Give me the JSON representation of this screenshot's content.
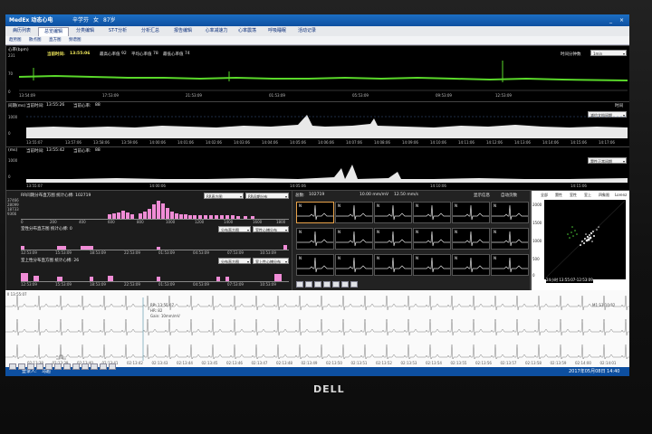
{
  "window": {
    "brand": "MedEx 动态心电",
    "patient_name": "辛学芬",
    "patient_sex": "女",
    "patient_age": "87岁",
    "close_label": "×",
    "min_label": "_"
  },
  "menu": [
    {
      "label": "病历列表"
    },
    {
      "label": "总览编辑"
    },
    {
      "label": "分类编辑"
    },
    {
      "label": "ST-T分析"
    },
    {
      "label": "分析汇总"
    },
    {
      "label": "报告编辑"
    },
    {
      "label": "心率减速力"
    },
    {
      "label": "心率震荡"
    },
    {
      "label": "呼吸睡眠"
    },
    {
      "label": "活动记录"
    }
  ],
  "submenu": [
    {
      "label": "趋势图"
    },
    {
      "label": "散点图"
    },
    {
      "label": "直方图"
    },
    {
      "label": "频谱图"
    }
  ],
  "hr_trend": {
    "axis_title": "心率(bpm)",
    "y_max": "231",
    "y_mid": "70",
    "y_min": "0",
    "current_label": "当前时间:",
    "current_time": "13:55:06",
    "max_hr_label": "最高心率值",
    "max_hr": "92",
    "avg_hr_label": "平均心率值",
    "avg_hr": "78",
    "min_hr_label": "最低心率值",
    "min_hr": "74",
    "ticks": [
      "13:54:09",
      "17:53:09",
      "21:53:09",
      "01:53:09",
      "05:53:09",
      "09:53:09",
      "12:53:09"
    ],
    "dropdown_label": "时间分钟数",
    "dropdown_value": "1min"
  },
  "rr_trend": {
    "axis_title": "间期(ms)",
    "y_max": "1000",
    "y_min": "0",
    "current_label": "当前时间:",
    "current_time": "13:55:26",
    "hr_label": "当前心率:",
    "hr": "88",
    "right_label": "时间",
    "dropdown_value": "减约文档间期"
  },
  "rr_trend2": {
    "axis_title": "(ms)",
    "y_max": "1000",
    "y_min": "0",
    "current_label": "当前时间:",
    "current_time": "13:55:42",
    "hr_label": "当前心率:",
    "hr": "88",
    "dropdown_value": "窦性正常间期"
  },
  "trend_ticks": [
    "13:55:07",
    "13:57:06",
    "13:58:06",
    "13:59:06",
    "14:00:06",
    "14:01:06",
    "14:02:06",
    "14:03:06",
    "14:04:06",
    "14:05:06",
    "14:06:06",
    "14:07:06",
    "14:08:06",
    "14:09:06",
    "14:10:06",
    "14:11:06",
    "14:12:06",
    "14:13:06",
    "14:14:06",
    "14:15:06",
    "14:16:06",
    "14:17:06"
  ],
  "histograms": [
    {
      "title": "RR间期分布直方图 统计心搏: 102719",
      "y_labels": [
        "37466",
        "28099",
        "18733",
        "9366"
      ],
      "x_ticks": [
        "0",
        "200",
        "400",
        "600",
        "800",
        "1000",
        "1200",
        "1400",
        "1600",
        "1800"
      ],
      "dropdown_value": "RR直方图",
      "dropdown2_value": "RR间期分布"
    },
    {
      "title": "室性分布直方图 统计心搏: 0",
      "y_labels": [],
      "x_ticks": [
        "12:53:09",
        "15:53:09",
        "18:53:09",
        "22:53:09",
        "01:53:09",
        "04:53:09",
        "07:53:09",
        "10:53:09"
      ],
      "dropdown_value": "分布直方图",
      "dropdown2_value": "室性心搏分布"
    },
    {
      "title": "室上性分布直方图 统计心搏: 26",
      "y_labels": [],
      "x_ticks": [
        "12:53:09",
        "15:53:09",
        "18:53:09",
        "22:53:09",
        "01:53:09",
        "04:53:09",
        "07:53:09",
        "10:53:09"
      ],
      "dropdown_value": "分布直方图",
      "dropdown2_value": "室上性心搏分布"
    }
  ],
  "templates": {
    "total_label": "总数:",
    "total": "102719",
    "speed": "10.00 mm/mV",
    "gain": "12.50 mm/s",
    "check1_label": "显示信息",
    "check2_label": "自动页数",
    "beats": [
      "N",
      "N",
      "N",
      "N",
      "N",
      "N",
      "N",
      "N",
      "N",
      "N",
      "N",
      "N",
      "N",
      "N",
      "N",
      "N",
      "N",
      "N"
    ]
  },
  "scatter": {
    "legend_total": "全部",
    "legend_normal": "窦性",
    "legend_vent": "室性",
    "legend_supra": "室上",
    "legend_other": "四象限",
    "mode": "Lorenz",
    "y_ticks": [
      "2000",
      "1500",
      "1000",
      "500",
      "0"
    ],
    "cursor_label": "24小时 13:55:07-12:53:09",
    "series_colors": {
      "normal": "#f5f5f5",
      "supra": "#4fcf3a"
    }
  },
  "ecg_strip": {
    "lead1_info": "II 13:55:07",
    "lead2_info": "V1 13:55:07",
    "lead3_info": "V5 13:55:07",
    "header1": "RR: 13:55:07",
    "header2": "HR: 82",
    "header3": "Gain: 10mm/mV",
    "right_tag": "M1:13:10:32",
    "time_ticks": [
      "02:13:38",
      "02:13:39",
      "02:13:40",
      "02:13:41",
      "02:13:42",
      "02:13:43",
      "02:13:44",
      "02:13:45",
      "02:13:46",
      "02:13:47",
      "02:13:48",
      "02:13:49",
      "02:13:50",
      "02:13:51",
      "02:13:52",
      "02:13:53",
      "02:13:54",
      "02:13:55",
      "02:13:56",
      "02:13:57",
      "02:13:58",
      "02:13:59",
      "02:14:00",
      "02:14:01"
    ]
  },
  "status": {
    "operator_label": "登录人:",
    "operator": "马超",
    "datetime": "2017年05月08日 14:40"
  },
  "monitor_brand": "DELL",
  "colors": {
    "accent": "#0d4fa0",
    "trend": "#5ad82a",
    "hist": "#f08cd6"
  }
}
